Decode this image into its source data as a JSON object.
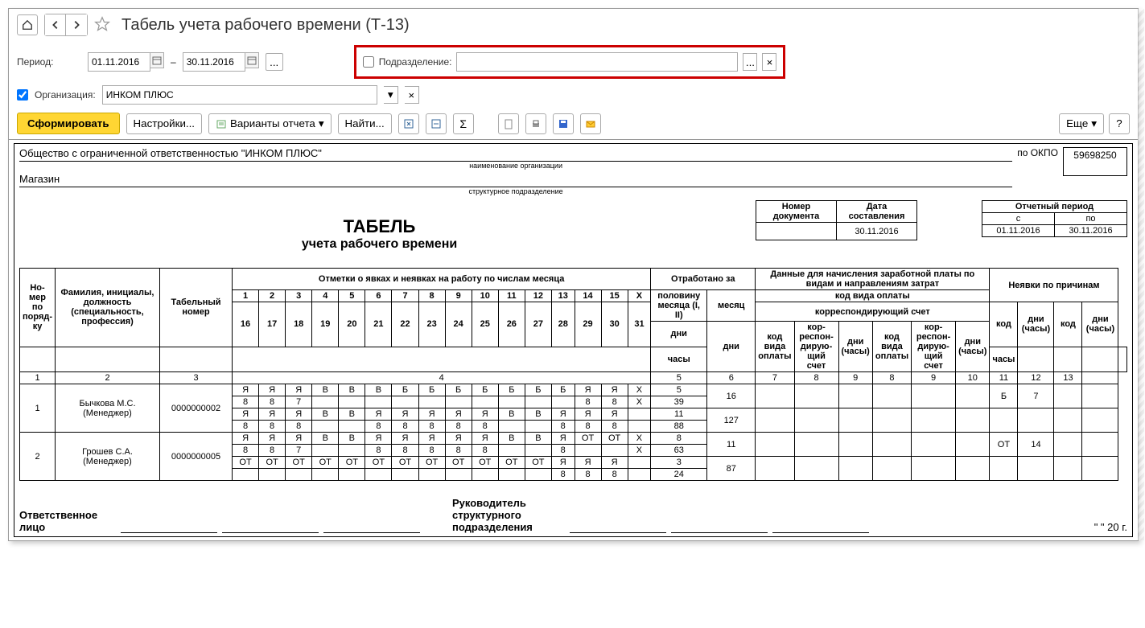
{
  "header": {
    "title": "Табель учета рабочего времени (Т-13)"
  },
  "period": {
    "label": "Период:",
    "from": "01.11.2016",
    "sep": "–",
    "to": "30.11.2016"
  },
  "org": {
    "label": "Организация:",
    "value": "ИНКОМ ПЛЮС"
  },
  "subdiv": {
    "label": "Подразделение:",
    "value": ""
  },
  "actions": {
    "form": "Сформировать",
    "settings": "Настройки...",
    "variants": "Варианты отчета",
    "find": "Найти...",
    "more": "Еще",
    "help": "?"
  },
  "report": {
    "org_name": "Общество с ограниченной ответственностью \"ИНКОМ ПЛЮС\"",
    "org_caption": "наименование организации",
    "dept_name": "Магазин",
    "dept_caption": "структурное подразделение",
    "okpo_label": "по ОКПО",
    "okpo": "59698250",
    "docnum_label": "Номер документа",
    "docdate_label": "Дата составления",
    "docdate": "30.11.2016",
    "period_label": "Отчетный период",
    "period_from_label": "с",
    "period_to_label": "по",
    "period_from": "01.11.2016",
    "period_to": "30.11.2016",
    "title1": "ТАБЕЛЬ",
    "title2": "учета  рабочего времени",
    "col_num": "Но-мер по поряд-ку",
    "col_fio": "Фамилия, инициалы, должность (специальность, профессия)",
    "col_tab": "Табельный номер",
    "col_marks": "Отметки о явках и неявках на работу по числам месяца",
    "col_worked": "Отработано за",
    "col_half": "половину месяца (I, II)",
    "col_month": "месяц",
    "col_days": "дни",
    "col_hours": "часы",
    "col_pay": "Данные для начисления заработной платы по видам и направлениям затрат",
    "col_paycode": "код вида оплаты",
    "col_corr": "корреспондирующий счет",
    "col_code": "код вида оплаты",
    "col_corr2": "кор-респон-дирую-щий счет",
    "col_dh": "дни (часы)",
    "col_absent": "Неявки по причинам",
    "col_kod": "код",
    "days1": [
      "1",
      "2",
      "3",
      "4",
      "5",
      "6",
      "7",
      "8",
      "9",
      "10",
      "11",
      "12",
      "13",
      "14",
      "15",
      "X"
    ],
    "days2": [
      "16",
      "17",
      "18",
      "19",
      "20",
      "21",
      "22",
      "23",
      "24",
      "25",
      "26",
      "27",
      "28",
      "29",
      "30",
      "31"
    ],
    "row_nums": [
      "1",
      "2",
      "3",
      "4",
      "5",
      "6",
      "7",
      "8",
      "9",
      "10",
      "11",
      "12",
      "13"
    ],
    "rows": [
      {
        "num": "1",
        "fio": "Бычкова М.С. (Менеджер)",
        "tab": "0000000002",
        "r1": [
          "Я",
          "Я",
          "Я",
          "В",
          "В",
          "В",
          "Б",
          "Б",
          "Б",
          "Б",
          "Б",
          "Б",
          "Б",
          "Я",
          "Я",
          "X"
        ],
        "r2": [
          "8",
          "8",
          "7",
          "",
          "",
          "",
          "",
          "",
          "",
          "",
          "",
          "",
          "",
          "8",
          "8",
          "X"
        ],
        "r3": [
          "Я",
          "Я",
          "Я",
          "В",
          "В",
          "Я",
          "Я",
          "Я",
          "Я",
          "Я",
          "В",
          "В",
          "Я",
          "Я",
          "Я",
          ""
        ],
        "r4": [
          "8",
          "8",
          "8",
          "",
          "",
          "8",
          "8",
          "8",
          "8",
          "8",
          "",
          "",
          "8",
          "8",
          "8",
          ""
        ],
        "half_days": [
          "5",
          "39",
          "11",
          "88"
        ],
        "month_days": "16",
        "month_hours": "127",
        "abs_code": "Б",
        "abs_val": "7"
      },
      {
        "num": "2",
        "fio": "Грошев  С.А. (Менеджер)",
        "tab": "0000000005",
        "r1": [
          "Я",
          "Я",
          "Я",
          "В",
          "В",
          "Я",
          "Я",
          "Я",
          "Я",
          "Я",
          "В",
          "В",
          "Я",
          "ОТ",
          "ОТ",
          "X"
        ],
        "r2": [
          "8",
          "8",
          "7",
          "",
          "",
          "8",
          "8",
          "8",
          "8",
          "8",
          "",
          "",
          "8",
          "",
          "",
          "X"
        ],
        "r3": [
          "ОТ",
          "ОТ",
          "ОТ",
          "ОТ",
          "ОТ",
          "ОТ",
          "ОТ",
          "ОТ",
          "ОТ",
          "ОТ",
          "ОТ",
          "ОТ",
          "Я",
          "Я",
          "Я",
          ""
        ],
        "r4": [
          "",
          "",
          "",
          "",
          "",
          "",
          "",
          "",
          "",
          "",
          "",
          "",
          "8",
          "8",
          "8",
          ""
        ],
        "half_days": [
          "8",
          "63",
          "3",
          "24"
        ],
        "month_days": "11",
        "month_hours": "87",
        "abs_code": "ОТ",
        "abs_val": "14"
      }
    ],
    "sig1": "Ответственное лицо",
    "sig2": "Руководитель структурного подразделения",
    "sig_date": "\"   \"            20    г."
  }
}
